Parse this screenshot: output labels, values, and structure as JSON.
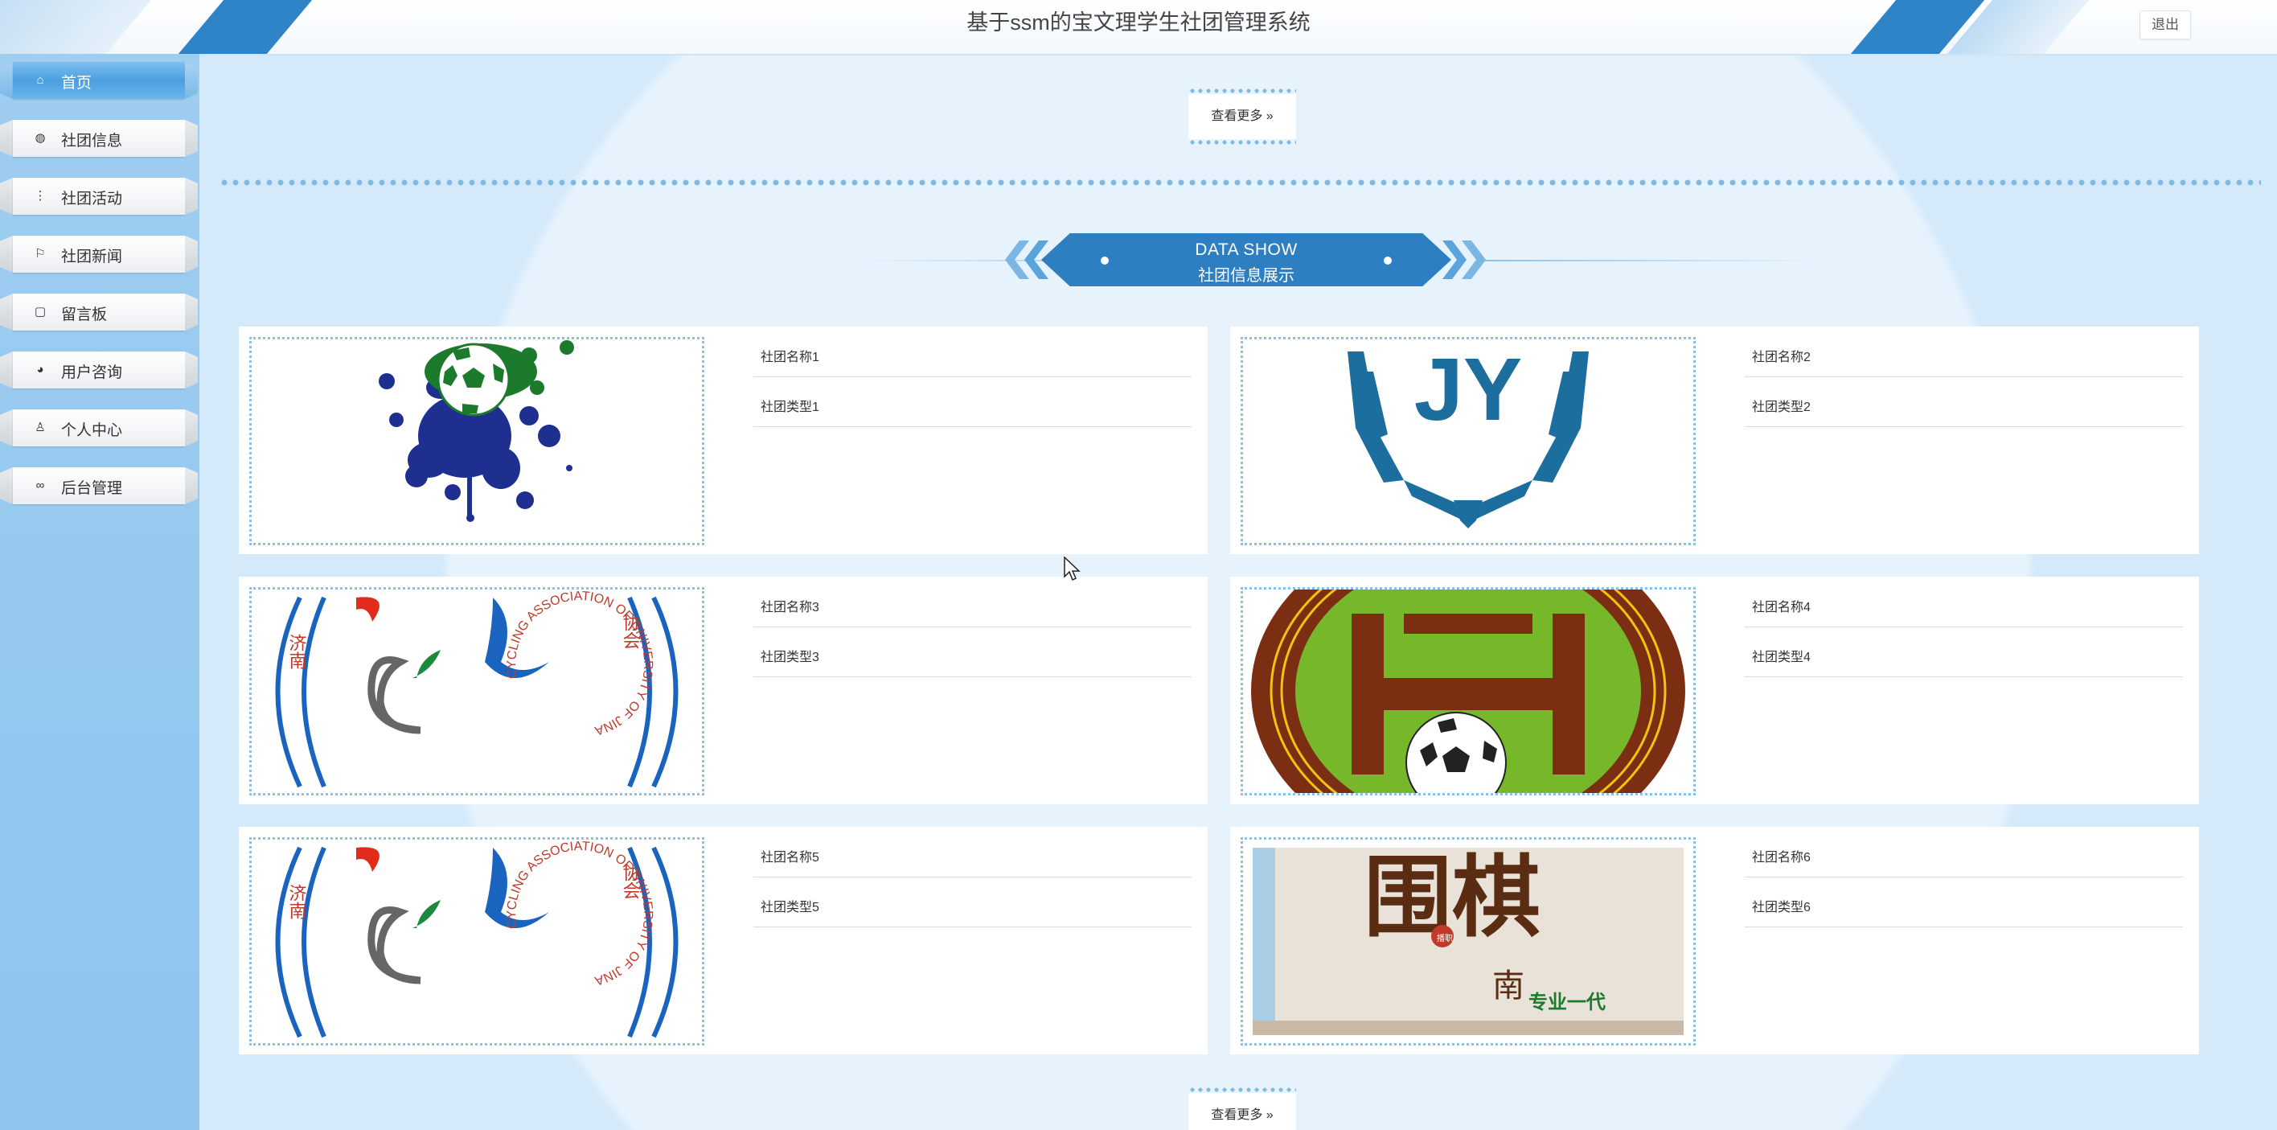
{
  "header": {
    "title": "基于ssm的宝文理学生社团管理系统",
    "logout_label": "退出"
  },
  "sidebar": {
    "items": [
      {
        "label": "首页",
        "icon": "home-icon",
        "active": true
      },
      {
        "label": "社团信息",
        "icon": "globe-icon",
        "active": false
      },
      {
        "label": "社团活动",
        "icon": "sliders-icon",
        "active": false
      },
      {
        "label": "社团新闻",
        "icon": "flag-icon",
        "active": false
      },
      {
        "label": "留言板",
        "icon": "note-icon",
        "active": false
      },
      {
        "label": "用户咨询",
        "icon": "chat-icon",
        "active": false
      },
      {
        "label": "个人中心",
        "icon": "user-icon",
        "active": false
      },
      {
        "label": "后台管理",
        "icon": "link-icon",
        "active": false
      }
    ]
  },
  "main": {
    "more_label": "查看更多 »",
    "banner": {
      "line1": "DATA SHOW",
      "line2": "社团信息展示"
    },
    "cards": [
      {
        "name": "社团名称1",
        "type": "社团类型1",
        "image": "paint-splash-soccer-logo"
      },
      {
        "name": "社团名称2",
        "type": "社团类型2",
        "image": "jy-eagle-logo"
      },
      {
        "name": "社团名称3",
        "type": "社团类型3",
        "image": "cycling-association-logo"
      },
      {
        "name": "社团名称4",
        "type": "社团类型4",
        "image": "football-club-badge"
      },
      {
        "name": "社团名称5",
        "type": "社团类型5",
        "image": "cycling-association-logo"
      },
      {
        "name": "社团名称6",
        "type": "社团类型6",
        "image": "chess-club-poster"
      }
    ],
    "logo_text": {
      "cycling_ring": "CYCLING ASSOCIATION OF UNIVERSITY OF JINA",
      "cycling_left": "济南",
      "cycling_right": "协会",
      "chess_main": "围棋",
      "chess_sub": "南",
      "chess_small": "专业一代",
      "chess_side": "播职",
      "jy_letters": "JY"
    }
  },
  "colors": {
    "accent": "#2e7fc2",
    "sidebar_bg": "#9fcdf0",
    "active_nav": "#4b9fe0",
    "page_bg": "#d7ecfb"
  }
}
